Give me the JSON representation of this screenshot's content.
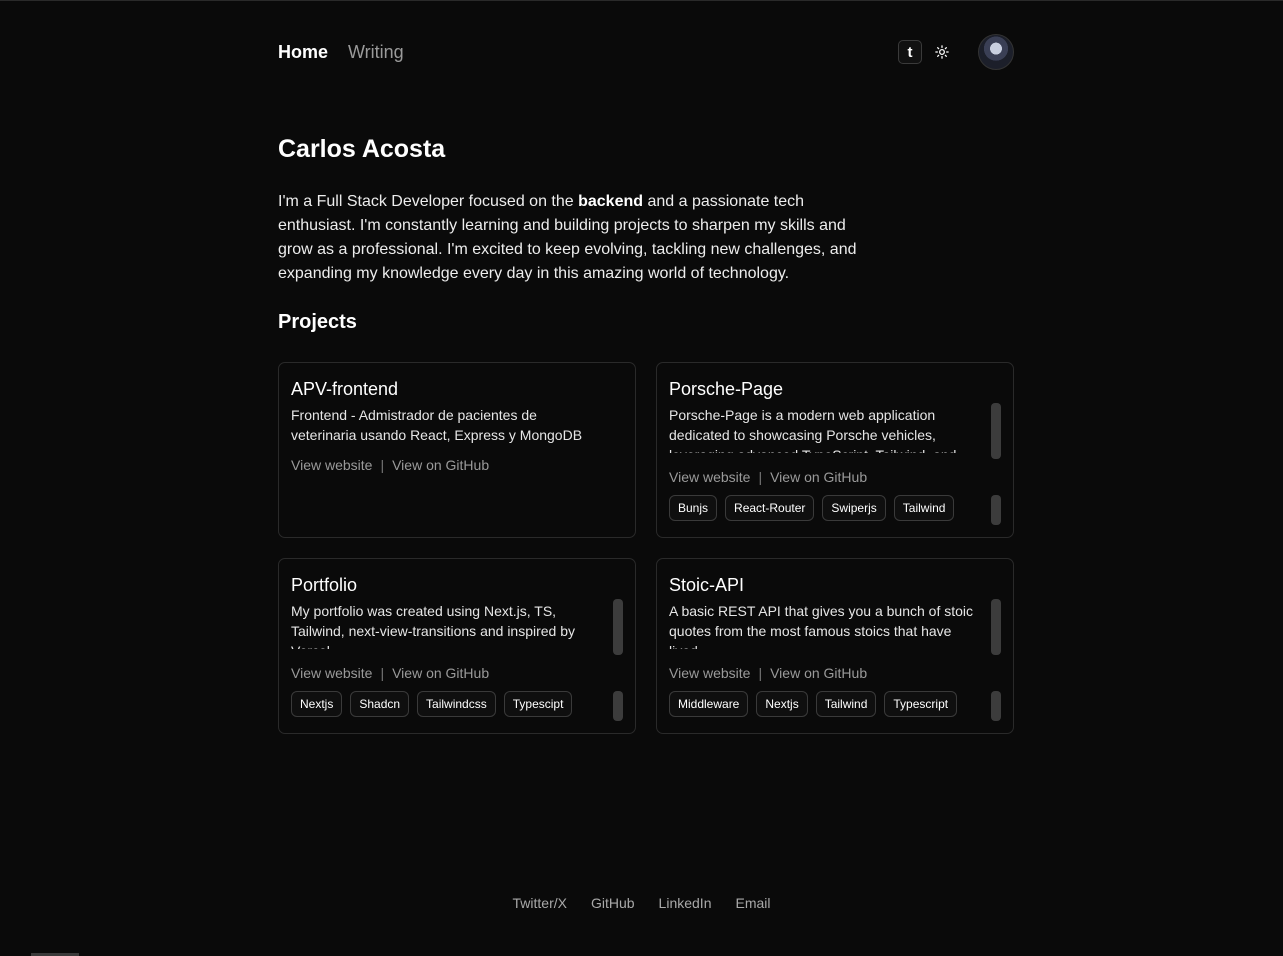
{
  "nav": {
    "home": "Home",
    "writing": "Writing",
    "kbd_label": "t"
  },
  "profile": {
    "name": "Carlos Acosta",
    "bio_prefix": "I'm a Full Stack Developer focused on the ",
    "bio_bold": "backend",
    "bio_suffix": " and a passionate tech enthusiast. I'm constantly learning and building projects to sharpen my skills and grow as a professional. I'm excited to keep evolving, tackling new challenges, and expanding my knowledge every day in this amazing world of technology."
  },
  "projects": {
    "title": "Projects",
    "items": [
      {
        "title": "APV-frontend",
        "description": "Frontend - Admistrador de pacientes de veterinaria usando React, Express y MongoDB",
        "link_website": "View website",
        "link_github": "View on GitHub",
        "tags": []
      },
      {
        "title": "Porsche-Page",
        "description": "Porsche-Page is a modern web application dedicated to showcasing Porsche vehicles, leveraging advanced TypeScript, Tailwind, and",
        "link_website": "View website",
        "link_github": "View on GitHub",
        "tags": [
          "Bunjs",
          "React-Router",
          "Swiperjs",
          "Tailwind"
        ]
      },
      {
        "title": "Portfolio",
        "description": "My portfolio was created using Next.js, TS, Tailwind, next-view-transitions and inspired by Vercel.",
        "link_website": "View website",
        "link_github": "View on GitHub",
        "tags": [
          "Nextjs",
          "Shadcn",
          "Tailwindcss",
          "Typescipt"
        ]
      },
      {
        "title": "Stoic-API",
        "description": "A basic REST API that gives you a bunch of stoic quotes from the most famous stoics that have lived.",
        "link_website": "View website",
        "link_github": "View on GitHub",
        "tags": [
          "Middleware",
          "Nextjs",
          "Tailwind",
          "Typescript"
        ]
      }
    ]
  },
  "footer": {
    "links": [
      "Twitter/X",
      "GitHub",
      "LinkedIn",
      "Email"
    ]
  },
  "icons": {
    "theme": "sun-icon",
    "avatar": "avatar"
  }
}
